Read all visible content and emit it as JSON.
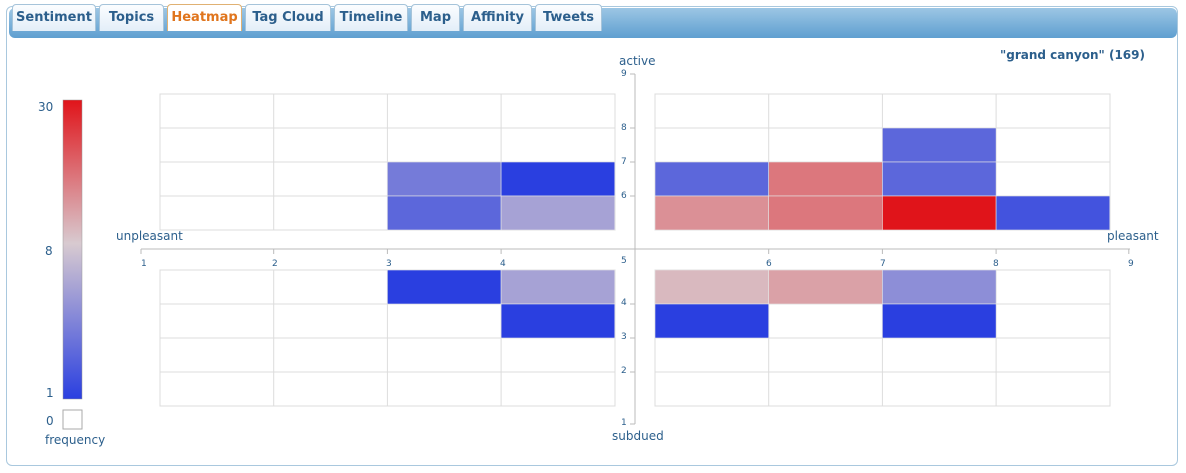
{
  "tabs": [
    {
      "label": "Sentiment",
      "active": false
    },
    {
      "label": "Topics",
      "active": false
    },
    {
      "label": "Heatmap",
      "active": true
    },
    {
      "label": "Tag Cloud",
      "active": false
    },
    {
      "label": "Timeline",
      "active": false
    },
    {
      "label": "Map",
      "active": false
    },
    {
      "label": "Affinity",
      "active": false
    },
    {
      "label": "Tweets",
      "active": false
    }
  ],
  "query": {
    "text": "\"grand canyon\" (169)"
  },
  "legend": {
    "max_label": "30",
    "mid_label": "8",
    "min_label": "1",
    "zero_label": "0",
    "title": "frequency",
    "colors": {
      "low": "#2a3fe0",
      "mid": "#d8cad0",
      "high": "#e0141a",
      "zero": "#ffffff"
    }
  },
  "chart_data": {
    "type": "heatmap",
    "xlabel_left": "unpleasant",
    "xlabel_right": "pleasant",
    "ylabel_top": "active",
    "ylabel_bottom": "subdued",
    "xlim": [
      1,
      9
    ],
    "ylim": [
      1,
      9
    ],
    "x_ticks": [
      "1",
      "2",
      "3",
      "4",
      "6",
      "7",
      "8",
      "9"
    ],
    "y_ticks": [
      "2",
      "3",
      "4",
      "5",
      "6",
      "7",
      "8",
      "9"
    ],
    "center_tick": "5",
    "y_ticks_bottom": "1",
    "cells": [
      {
        "x": 3,
        "y": 6,
        "count": 4
      },
      {
        "x": 3,
        "y": 5,
        "count": 3
      },
      {
        "x": 4,
        "y": 6,
        "count": 1
      },
      {
        "x": 4,
        "y": 5,
        "count": 6
      },
      {
        "x": 5,
        "y": 6,
        "count": 3
      },
      {
        "x": 5,
        "y": 5,
        "count": 15
      },
      {
        "x": 6,
        "y": 6,
        "count": 18
      },
      {
        "x": 6,
        "y": 5,
        "count": 18
      },
      {
        "x": 7,
        "y": 7,
        "count": 3
      },
      {
        "x": 7,
        "y": 6,
        "count": 3
      },
      {
        "x": 7,
        "y": 5,
        "count": 30
      },
      {
        "x": 8,
        "y": 5,
        "count": 2
      },
      {
        "x": 3,
        "y": 4,
        "count": 1
      },
      {
        "x": 4,
        "y": 4,
        "count": 6
      },
      {
        "x": 4,
        "y": 3,
        "count": 1
      },
      {
        "x": 5,
        "y": 4,
        "count": 10
      },
      {
        "x": 5,
        "y": 3,
        "count": 1
      },
      {
        "x": 6,
        "y": 4,
        "count": 13
      },
      {
        "x": 7,
        "y": 4,
        "count": 5
      },
      {
        "x": 7,
        "y": 3,
        "count": 1
      }
    ]
  }
}
